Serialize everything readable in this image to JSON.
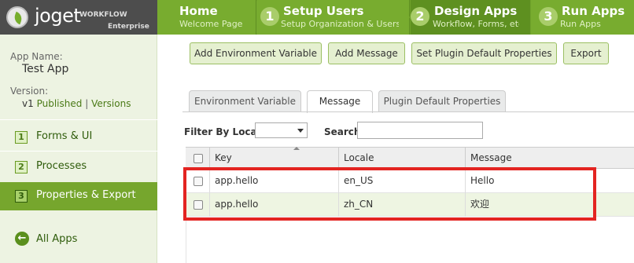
{
  "brand": {
    "name": "joget",
    "workflow": "WORKFLOW",
    "edition": "Enterprise"
  },
  "steps": [
    {
      "num": "",
      "title": "Home",
      "subtitle": "Welcome Page"
    },
    {
      "num": "1",
      "title": "Setup Users",
      "subtitle": "Setup Organization & Users"
    },
    {
      "num": "2",
      "title": "Design Apps",
      "subtitle": "Workflow, Forms, etc"
    },
    {
      "num": "3",
      "title": "Run Apps",
      "subtitle": "Run Apps"
    }
  ],
  "sidebar": {
    "app_name_label": "App Name:",
    "app_name": "Test App",
    "version_label": "Version:",
    "version": "v1",
    "published_link": "Published",
    "separator": "|",
    "versions_link": "Versions",
    "items": [
      {
        "num": "1",
        "label": "Forms & UI"
      },
      {
        "num": "2",
        "label": "Processes"
      },
      {
        "num": "3",
        "label": "Properties & Export"
      }
    ],
    "all_apps": "All Apps"
  },
  "actions": {
    "add_env": "Add Environment Variable",
    "add_message": "Add Message",
    "set_plugin": "Set Plugin Default Properties",
    "export": "Export"
  },
  "tabs": [
    {
      "label": "Environment Variable"
    },
    {
      "label": "Message"
    },
    {
      "label": "Plugin Default Properties"
    }
  ],
  "filter": {
    "locale_label": "Filter By Locale",
    "locale_value": "",
    "search_label": "Search",
    "search_value": ""
  },
  "table": {
    "columns": [
      "Key",
      "Locale",
      "Message"
    ],
    "rows": [
      {
        "key": "app.hello",
        "locale": "en_US",
        "message": "Hello"
      },
      {
        "key": "app.hello",
        "locale": "zh_CN",
        "message": "欢迎"
      }
    ]
  },
  "colors": {
    "brand_green": "#78ac2f",
    "highlight": "#e32421"
  }
}
